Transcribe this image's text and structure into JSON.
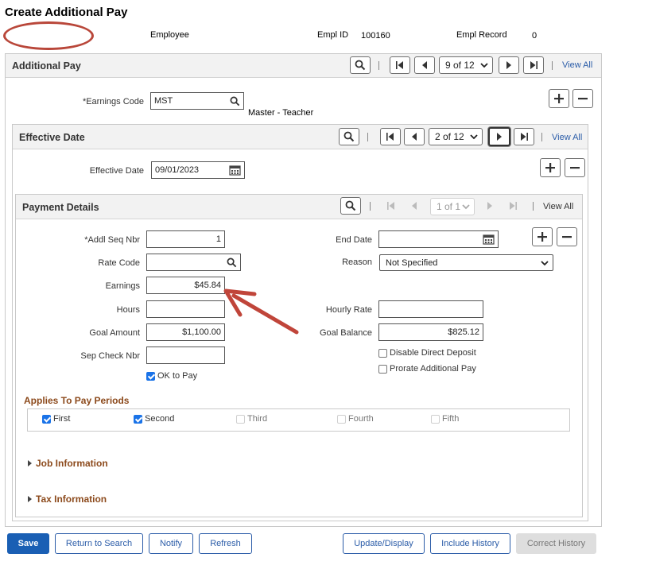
{
  "page": {
    "title": "Create Additional Pay"
  },
  "header": {
    "employee_label": "Employee",
    "empl_id_label": "Empl ID",
    "empl_id": "100160",
    "empl_record_label": "Empl Record",
    "empl_record": "0"
  },
  "additional_pay": {
    "title": "Additional Pay",
    "pager": "9 of 12",
    "view_all": "View All",
    "earnings_code_label": "*Earnings Code",
    "earnings_code": "MST",
    "earnings_desc": "Master - Teacher"
  },
  "effective_date": {
    "title": "Effective Date",
    "pager": "2 of 12",
    "view_all": "View All",
    "label": "Effective Date",
    "value": "09/01/2023"
  },
  "payment_details": {
    "title": "Payment Details",
    "pager": "1 of 1",
    "view_all": "View All",
    "addl_seq_label": "*Addl Seq Nbr",
    "addl_seq": "1",
    "rate_code_label": "Rate Code",
    "rate_code": "",
    "earnings_label": "Earnings",
    "earnings": "$45.84",
    "hours_label": "Hours",
    "hours": "",
    "goal_amount_label": "Goal Amount",
    "goal_amount": "$1,100.00",
    "sep_check_label": "Sep Check Nbr",
    "sep_check": "",
    "ok_to_pay": "OK to Pay",
    "end_date_label": "End Date",
    "end_date": "",
    "reason_label": "Reason",
    "reason": "Not Specified",
    "hourly_rate_label": "Hourly Rate",
    "hourly_rate": "",
    "goal_balance_label": "Goal Balance",
    "goal_balance": "$825.12",
    "disable_dd": "Disable Direct Deposit",
    "prorate": "Prorate Additional Pay"
  },
  "pay_periods": {
    "title": "Applies To Pay Periods",
    "first": "First",
    "second": "Second",
    "third": "Third",
    "fourth": "Fourth",
    "fifth": "Fifth"
  },
  "collapsibles": {
    "job": "Job Information",
    "tax": "Tax Information"
  },
  "buttons": {
    "save": "Save",
    "return": "Return to Search",
    "notify": "Notify",
    "refresh": "Refresh",
    "update": "Update/Display",
    "include_history": "Include History",
    "correct_history": "Correct History"
  },
  "colors": {
    "annotation": "#c0453a",
    "link": "#2b5ca8",
    "primary": "#1a5fb4",
    "section": "#8c4a1c"
  }
}
